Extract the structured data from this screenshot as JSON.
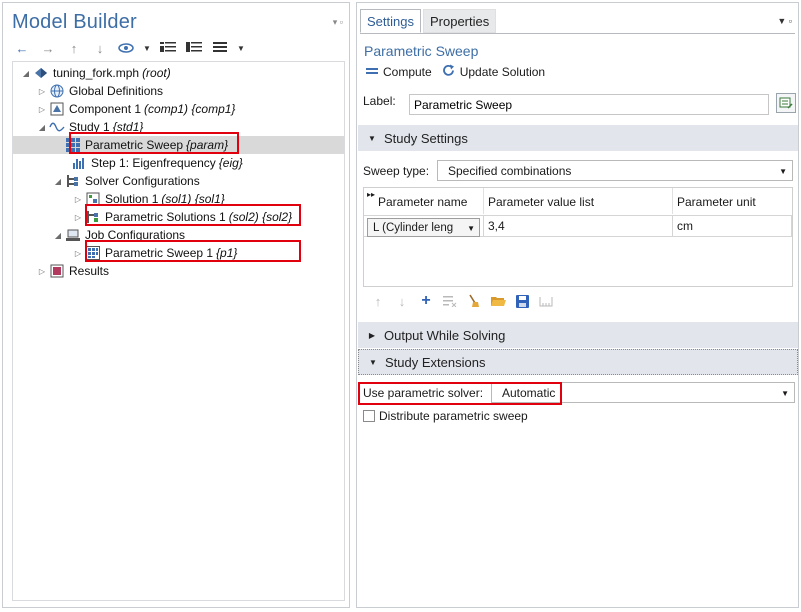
{
  "model_builder": {
    "title": "Model Builder",
    "tree": [
      {
        "label": "tuning_fork.mph",
        "tag": "(root)",
        "icon": "model-file-icon",
        "expanded": true
      },
      {
        "label": "Global Definitions",
        "tag": "",
        "icon": "globe-icon",
        "expanded": false
      },
      {
        "label": "Component 1",
        "tag": "(comp1) {comp1}",
        "icon": "component-icon",
        "expanded": false
      },
      {
        "label": "Study 1",
        "tag": "{std1}",
        "icon": "study-icon",
        "expanded": true
      },
      {
        "label": "Parametric Sweep",
        "tag": "{param}",
        "icon": "parametric-sweep-icon",
        "selected": true
      },
      {
        "label": "Step 1: Eigenfrequency",
        "tag": "{eig}",
        "icon": "eigenfrequency-icon"
      },
      {
        "label": "Solver Configurations",
        "tag": "",
        "icon": "solver-configurations-icon",
        "expanded": true
      },
      {
        "label": "Solution 1",
        "tag": "(sol1) {sol1}",
        "icon": "solution-icon",
        "expanded": false
      },
      {
        "label": "Parametric Solutions 1",
        "tag": "(sol2) {sol2}",
        "icon": "parametric-solutions-icon",
        "expanded": false
      },
      {
        "label": "Job Configurations",
        "tag": "",
        "icon": "job-configurations-icon",
        "expanded": true
      },
      {
        "label": "Parametric Sweep 1",
        "tag": "{p1}",
        "icon": "parametric-sweep-job-icon",
        "expanded": false
      },
      {
        "label": "Results",
        "tag": "",
        "icon": "results-icon",
        "expanded": false
      }
    ]
  },
  "settings": {
    "tabs": [
      {
        "label": "Settings",
        "active": true
      },
      {
        "label": "Properties",
        "active": false
      }
    ],
    "node_title": "Parametric Sweep",
    "compute_label": "Compute",
    "update_label": "Update Solution",
    "label_caption": "Label:",
    "label_value": "Parametric Sweep",
    "study_settings": {
      "header": "Study Settings",
      "sweep_type_label": "Sweep type:",
      "sweep_type_value": "Specified combinations",
      "columns": [
        "Parameter name",
        "Parameter value list",
        "Parameter unit"
      ],
      "rows": [
        {
          "name": "L (Cylinder leng",
          "values": "3,4",
          "unit": "cm"
        }
      ]
    },
    "output_header": "Output While Solving",
    "extensions": {
      "header": "Study Extensions",
      "solver_label": "Use parametric solver:",
      "solver_value": "Automatic",
      "distribute_label": "Distribute parametric sweep",
      "distribute_checked": false
    }
  },
  "colors": {
    "accent": "#3d6ea5",
    "highlight": "#e0000e",
    "section_bg": "#e2e6ec",
    "selection_bg": "#d9d9d9"
  }
}
